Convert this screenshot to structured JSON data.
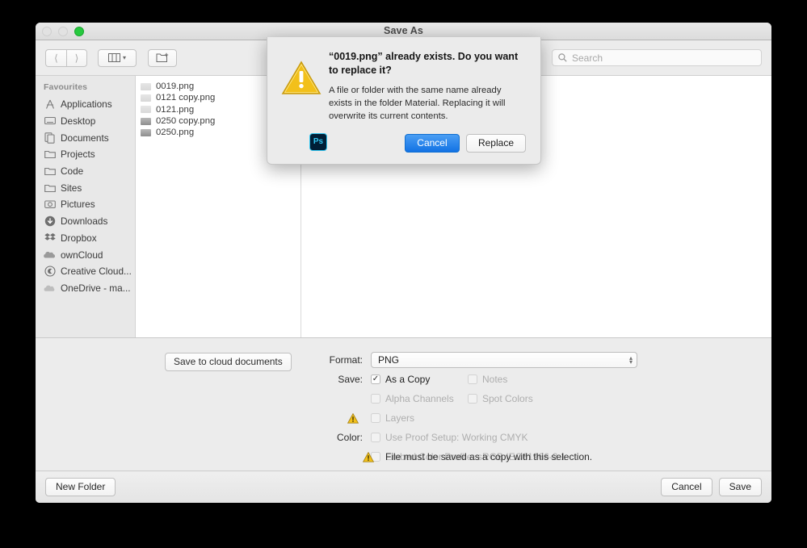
{
  "window": {
    "title": "Save As",
    "traffic_lights": [
      "close-inactive",
      "minimize-inactive",
      "zoom-green"
    ]
  },
  "toolbar": {
    "back_icon": "chevron-left-icon",
    "forward_icon": "chevron-right-icon",
    "view_icon": "column-view-icon",
    "view_chevron": "chevron-down-icon",
    "new_folder_icon": "new-folder-icon",
    "search": {
      "icon": "search-icon",
      "placeholder": "Search",
      "value": ""
    }
  },
  "sidebar": {
    "header": "Favourites",
    "items": [
      {
        "label": "Applications",
        "icon": "applications-icon"
      },
      {
        "label": "Desktop",
        "icon": "desktop-icon"
      },
      {
        "label": "Documents",
        "icon": "documents-icon"
      },
      {
        "label": "Projects",
        "icon": "folder-icon"
      },
      {
        "label": "Code",
        "icon": "folder-icon"
      },
      {
        "label": "Sites",
        "icon": "folder-icon"
      },
      {
        "label": "Pictures",
        "icon": "pictures-icon"
      },
      {
        "label": "Downloads",
        "icon": "downloads-icon"
      },
      {
        "label": "Dropbox",
        "icon": "dropbox-icon"
      },
      {
        "label": "ownCloud",
        "icon": "owncloud-icon"
      },
      {
        "label": "Creative Cloud...",
        "icon": "creative-cloud-icon"
      },
      {
        "label": "OneDrive - ma...",
        "icon": "onedrive-icon"
      }
    ]
  },
  "filelist": {
    "files": [
      {
        "name": "0019.png",
        "thumb": "light"
      },
      {
        "name": "0121 copy.png",
        "thumb": "light"
      },
      {
        "name": "0121.png",
        "thumb": "light"
      },
      {
        "name": "0250 copy.png",
        "thumb": "dark"
      },
      {
        "name": "0250.png",
        "thumb": "dark"
      }
    ]
  },
  "options": {
    "cloud_button": "Save to cloud documents",
    "format_label": "Format:",
    "format_value": "PNG",
    "save_label": "Save:",
    "color_label": "Color:",
    "checkboxes": {
      "as_a_copy": {
        "label": "As a Copy",
        "checked": true,
        "enabled": true
      },
      "notes": {
        "label": "Notes",
        "checked": false,
        "enabled": false
      },
      "alpha_channels": {
        "label": "Alpha Channels",
        "checked": false,
        "enabled": false
      },
      "spot_colors": {
        "label": "Spot Colors",
        "checked": false,
        "enabled": false
      },
      "layers": {
        "label": "Layers",
        "checked": false,
        "enabled": false,
        "warning": true
      },
      "use_proof_setup": {
        "label": "Use Proof Setup:  Working CMYK",
        "checked": false,
        "enabled": false
      },
      "embed_color_profile": {
        "label": "Embed Color Profile:  sRGB IEC61966-2.1",
        "checked": false,
        "enabled": false
      }
    },
    "footnote": {
      "icon": "warning-triangle-icon",
      "text": "File must be saved as a copy with this selection."
    }
  },
  "bottombar": {
    "new_folder": "New Folder",
    "cancel": "Cancel",
    "save": "Save"
  },
  "replace_sheet": {
    "icon": "warning-triangle-photoshop-icon",
    "badge_text": "Ps",
    "title": "“0019.png” already exists. Do you want to replace it?",
    "message": "A file or folder with the same name already exists in the folder Material. Replacing it will overwrite its current contents.",
    "cancel_label": "Cancel",
    "replace_label": "Replace"
  },
  "colors": {
    "accent_blue": "#1272e4",
    "warning_yellow": "#f5c518",
    "photoshop_cyan": "#31c5f0",
    "window_chrome": "#ececec",
    "green_light": "#27c93f"
  }
}
